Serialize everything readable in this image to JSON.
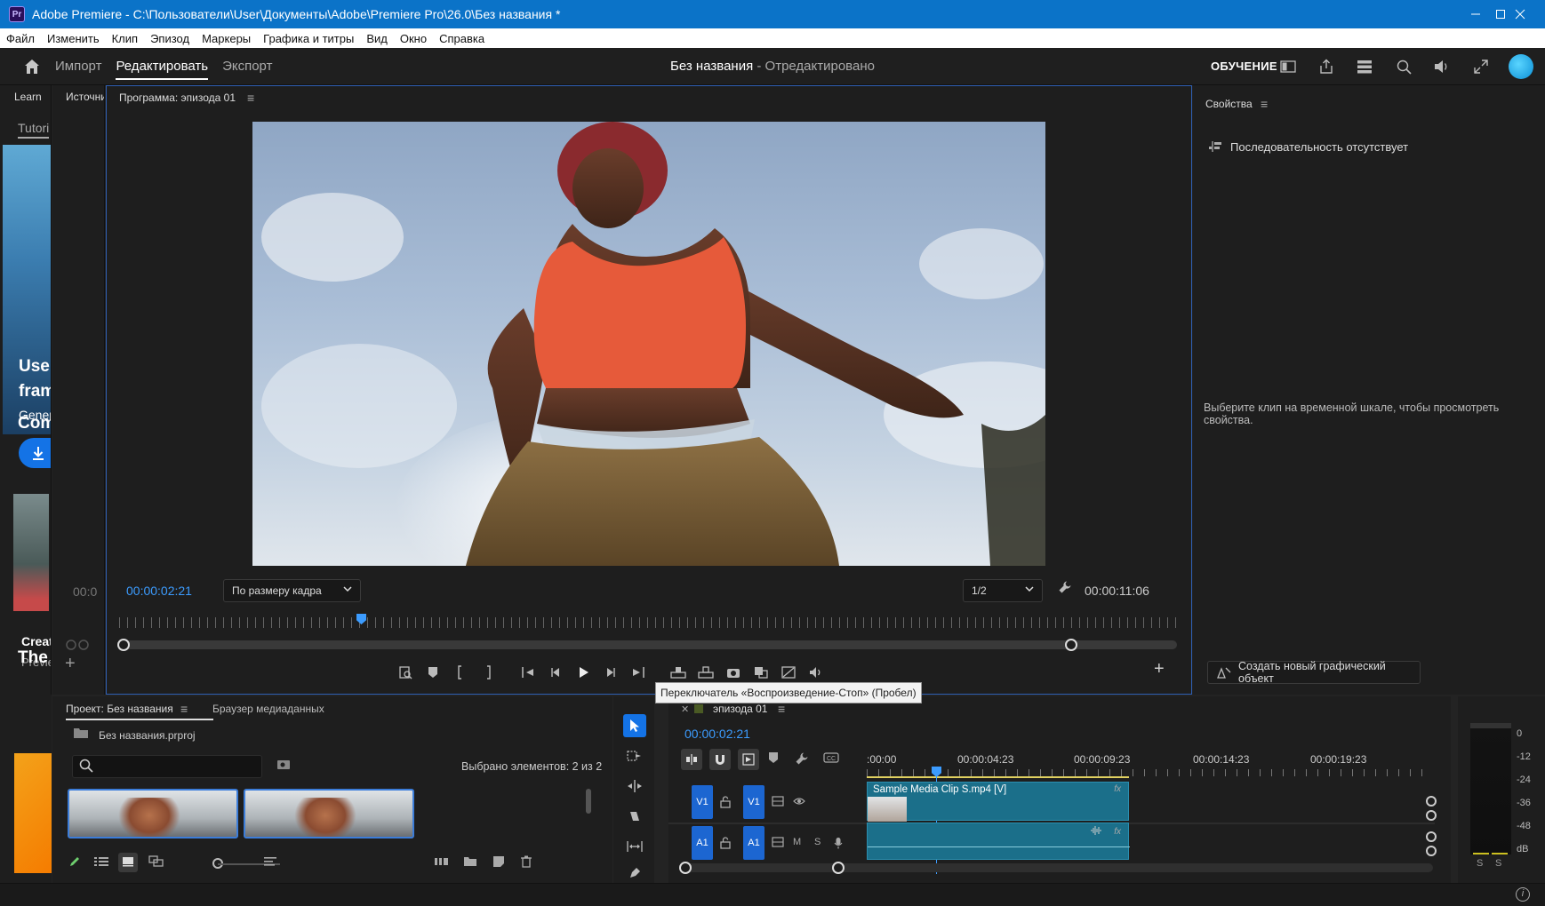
{
  "window": {
    "title": "Adobe Premiere - C:\\Пользователи\\User\\Документы\\Adobe\\Premiere Pro\\26.0\\Без названия *",
    "app_badge": "Pr"
  },
  "menu": [
    "Файл",
    "Изменить",
    "Клип",
    "Эпизод",
    "Маркеры",
    "Графика и титры",
    "Вид",
    "Окно",
    "Справка"
  ],
  "header": {
    "tabs": [
      "Импорт",
      "Редактировать",
      "Экспорт"
    ],
    "active_tab": "Редактировать",
    "doc_title": "Без названия",
    "doc_status": " - Отредактировано",
    "learn_label": "ОБУЧЕНИЕ"
  },
  "learn_panel": {
    "tab": "Learn",
    "subtab": "Tutori",
    "promo_line1": "Use",
    "promo_line2": "fram",
    "promo_sub": "Gener",
    "section1": "Com",
    "card_title": "Creat",
    "card_sub": "Previe",
    "section2": "The"
  },
  "source_panel": {
    "tab": "Источни",
    "timecode": "00:0"
  },
  "program": {
    "tab": "Программа: эпизода 01",
    "timecode_current": "00:00:02:21",
    "fit_select": "По размеру кадра",
    "resolution_select": "1/2",
    "timecode_duration": "00:00:11:06",
    "scrub_progress": 0.2
  },
  "tooltip": "Переключатель «Воспроизведение-Стоп» (Пробел)",
  "properties": {
    "tab": "Свойства",
    "no_sequence": "Последовательность отсутствует",
    "hint": "Выберите клип на временной шкале, чтобы просмотреть свойства.",
    "new_graphic": "Создать новый графический объект"
  },
  "project": {
    "tab": "Проект: Без названия",
    "tab2": "Браузер медиаданных",
    "file_name": "Без названия.prproj",
    "search_placeholder": "",
    "selected_count": "Выбрано элементов: 2 из 2"
  },
  "timeline": {
    "tab": "эпизода 01",
    "timecode": "00:00:02:21",
    "ruler_ticks": [
      ":00:00",
      "00:00:04:23",
      "00:00:09:23",
      "00:00:14:23",
      "00:00:19:23"
    ],
    "video_track": {
      "source": "V1",
      "target": "V1"
    },
    "audio_track": {
      "source": "A1",
      "target": "A1",
      "mute": "M",
      "solo": "S"
    },
    "video_clip": "Sample Media Clip S.mp4 [V]",
    "fx_label": "fx"
  },
  "meter": {
    "labels": [
      "0",
      "-12",
      "-24",
      "-36",
      "-48",
      "dB"
    ],
    "solo_labels": [
      "S",
      "S"
    ]
  },
  "colors": {
    "accent": "#1473e6",
    "timecode": "#3c9cff",
    "titlebar": "#0b73c8",
    "clip": "#1b6f8a"
  }
}
